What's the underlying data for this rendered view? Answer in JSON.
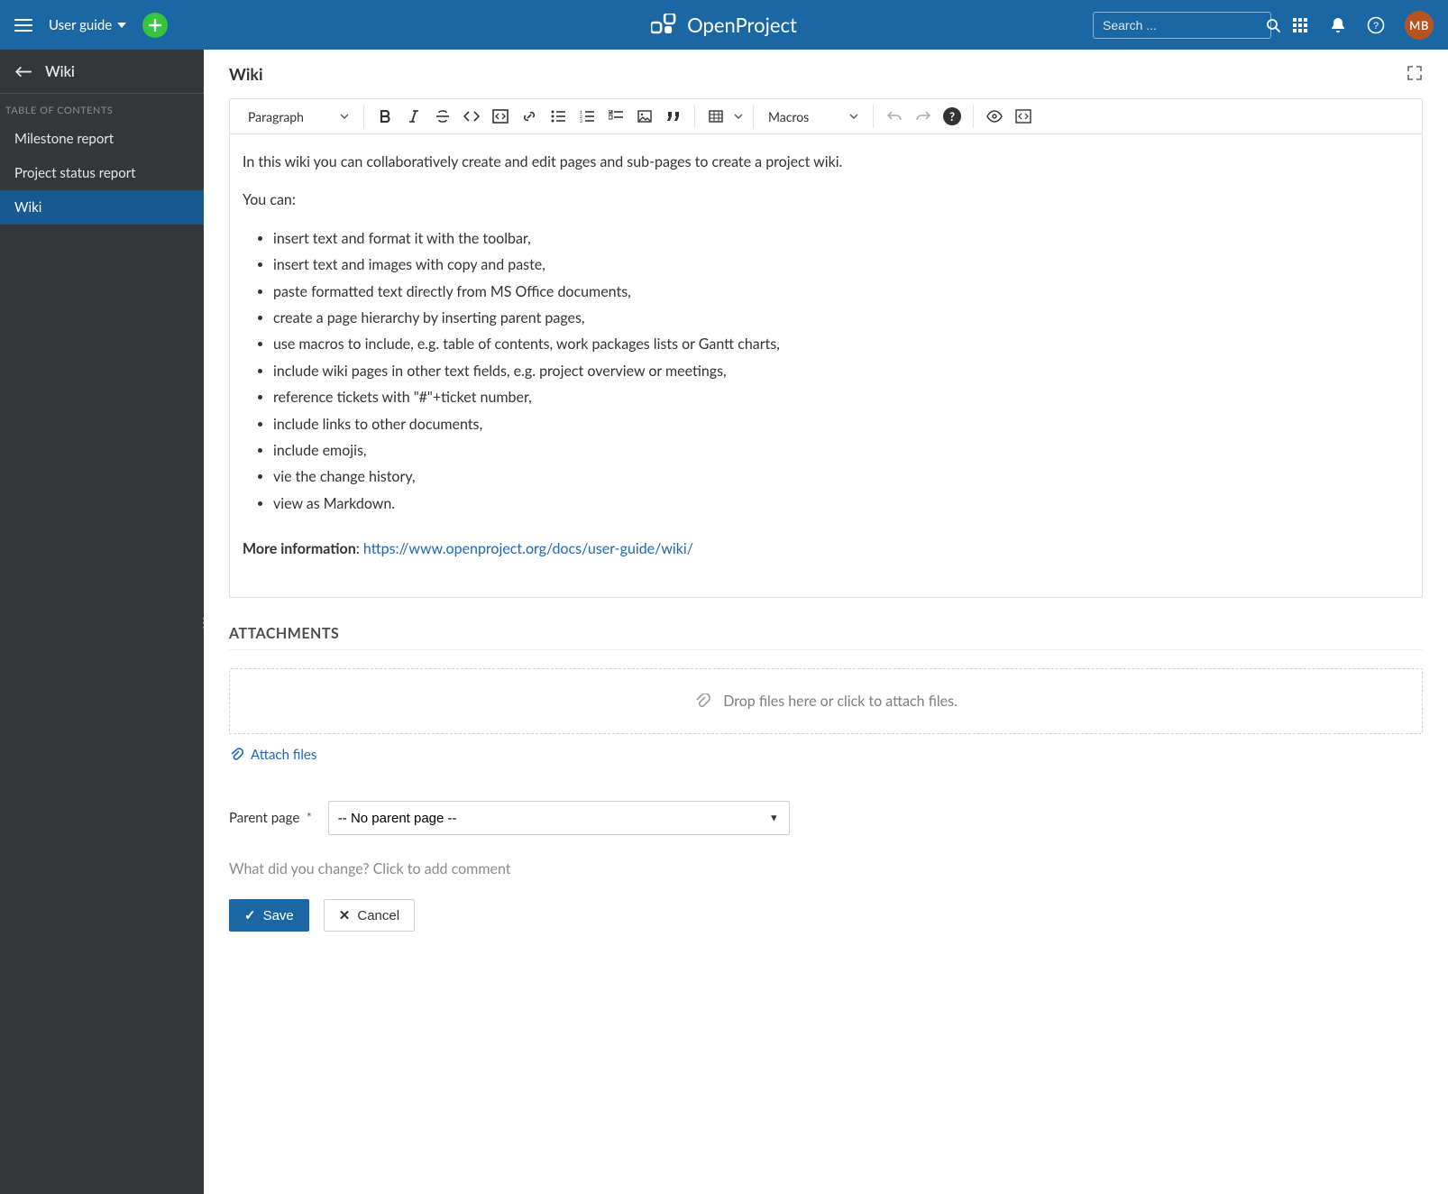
{
  "topbar": {
    "project_name": "User guide",
    "search_placeholder": "Search ...",
    "brand": "OpenProject",
    "avatar_initials": "MB"
  },
  "sidebar": {
    "title": "Wiki",
    "toc_label": "Table of contents",
    "items": [
      {
        "label": "Milestone report",
        "active": false
      },
      {
        "label": "Project status report",
        "active": false
      },
      {
        "label": "Wiki",
        "active": true
      }
    ]
  },
  "page": {
    "title": "Wiki"
  },
  "toolbar": {
    "heading": "Paragraph",
    "macros": "Macros"
  },
  "content": {
    "intro": "In this wiki you can collaboratively create and edit pages and sub-pages to create a project wiki.",
    "you_can": "You can:",
    "bullets": [
      "insert text and format it with the toolbar,",
      "insert text and images with copy and paste,",
      "paste formatted text directly from MS Office documents,",
      "create a page hierarchy by inserting parent pages,",
      "use macros to include, e.g. table of contents, work packages lists or Gantt charts,",
      "include wiki pages in other text fields, e.g. project overview or meetings,",
      "reference tickets with \"#\"+ticket number,",
      "include links to other documents,",
      "include emojis,",
      "vie the change history,",
      "view as Markdown."
    ],
    "more_info_label": "More information",
    "more_info_url": "https://www.openproject.org/docs/user-guide/wiki/"
  },
  "attachments": {
    "heading": "Attachments",
    "dropzone": "Drop files here or click to attach files.",
    "attach_link": "Attach files"
  },
  "parent_page": {
    "label": "Parent page",
    "selected": "-- No parent page --"
  },
  "comment": {
    "placeholder": "What did you change? Click to add comment"
  },
  "buttons": {
    "save": "Save",
    "cancel": "Cancel"
  }
}
